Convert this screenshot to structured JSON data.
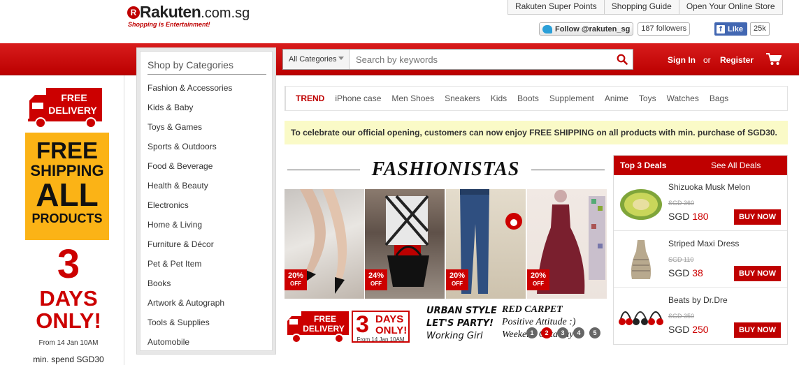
{
  "header": {
    "logo_mark": "R",
    "logo_brand": "Rakuten",
    "logo_domain": ".com.sg",
    "tagline": "Shopping is Entertainment!",
    "top_links": [
      "Rakuten Super Points",
      "Shopping Guide",
      "Open Your Online Store"
    ],
    "twitter_follow": "Follow @rakuten_sg",
    "twitter_followers": "187 followers",
    "facebook_like": "Like",
    "facebook_count": "25k"
  },
  "search": {
    "category": "All Categories",
    "placeholder": "Search by keywords"
  },
  "account": {
    "sign_in": "Sign In",
    "or": "or",
    "register": "Register"
  },
  "categories": {
    "title": "Shop by Categories",
    "items": [
      "Fashion & Accessories",
      "Kids & Baby",
      "Toys & Games",
      "Sports & Outdoors",
      "Food & Beverage",
      "Health & Beauty",
      "Electronics",
      "Home & Living",
      "Furniture & Décor",
      "Pet & Pet Item",
      "Books",
      "Artwork & Autograph",
      "Tools & Supplies",
      "Automobile"
    ]
  },
  "left_banner": {
    "truck_line1": "FREE",
    "truck_line2": "DELIVERY",
    "yellow_line1": "FREE",
    "yellow_line2": "SHIPPING",
    "yellow_line3": "ALL",
    "yellow_line4": "PRODUCTS",
    "big_number": "3",
    "days_line1": "DAYS",
    "days_line2": "ONLY!",
    "from": "From 14 Jan 10AM",
    "min_spend": "min. spend SGD30"
  },
  "trend": {
    "label": "TREND",
    "items": [
      "iPhone case",
      "Men Shoes",
      "Sneakers",
      "Kids",
      "Boots",
      "Supplement",
      "Anime",
      "Toys",
      "Watches",
      "Bags"
    ]
  },
  "promo_text": "To celebrate our official opening, customers can now enjoy FREE SHIPPING on all products with min. purchase of SGD30.",
  "fashion": {
    "title": "FASHIONISTAS",
    "discounts": [
      "20%",
      "24%",
      "20%",
      "20%"
    ],
    "off": "OFF",
    "banner_truck_1": "FREE",
    "banner_truck_2": "DELIVERY",
    "banner_days_1": "3",
    "banner_days_2": "DAYS",
    "banner_days_3": "ONLY!",
    "banner_from": "From 14 Jan 10AM",
    "urban_1": "URBAN STYLE",
    "urban_2": "LET'S PARTY!",
    "urban_3": "Working Girl",
    "carpet_1": "RED CARPET",
    "carpet_2": "Positive Attitude :)",
    "carpet_3": "Weekend Getaway",
    "dots": [
      "1",
      "2",
      "3",
      "4",
      "5"
    ],
    "active_dot": "2"
  },
  "deals": {
    "title": "Top 3 Deals",
    "see_all": "See All Deals",
    "items": [
      {
        "name": "Shizuoka Musk Melon",
        "old": "SGD 360",
        "currency": "SGD",
        "price": "180",
        "button": "BUY NOW"
      },
      {
        "name": "Striped Maxi Dress",
        "old": "SGD 110",
        "currency": "SGD",
        "price": "38",
        "button": "BUY NOW"
      },
      {
        "name": "Beats by Dr.Dre",
        "old": "SGD 350",
        "currency": "SGD",
        "price": "250",
        "button": "BUY NOW"
      }
    ]
  },
  "colors": {
    "brand_red": "#bf0000",
    "promo_yellow": "#fafac7",
    "banner_orange": "#fbb316"
  }
}
